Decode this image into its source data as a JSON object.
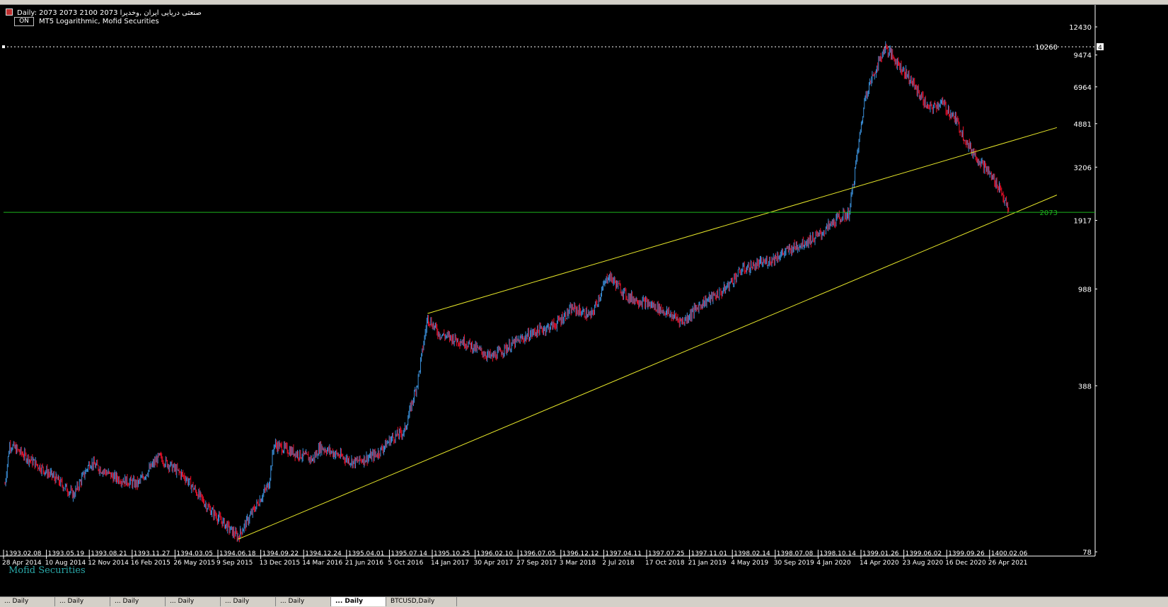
{
  "header": {
    "info_line": "Daily:  2073 2073 2100 2073  صنعتی دریایی ایران ,وخدیرا",
    "info_line2": "MT5 Logarithmic, Mofid Securities",
    "on_label": "ON"
  },
  "watermark": "Mofid Securities",
  "price_axis": {
    "labels": [
      "12430",
      "10260",
      "9474",
      "6964",
      "4881",
      "3206",
      "2073",
      "1917",
      "988",
      "388",
      "78"
    ],
    "marker": "4"
  },
  "time_axis": {
    "top_labels": [
      "1393.02.08",
      "1393.05.19",
      "1393.08.21",
      "1393.11.27",
      "1394.03.05",
      "1394.06.18",
      "1394.09.22",
      "1394.12.24",
      "1395.04.01",
      "1395.07.14",
      "1395.10.25",
      "1396.02.10",
      "1396.07.05",
      "1396.12.12",
      "1397.04.11",
      "1397.07.25",
      "1397.11.01",
      "1398.02.14",
      "1398.07.08",
      "1398.10.14",
      "1399.01.26",
      "1399.06.02",
      "1399.09.26",
      "1400.02.06"
    ],
    "bottom_labels": [
      "28 Apr 2014",
      "10 Aug 2014",
      "12 Nov 2014",
      "16 Feb 2015",
      "26 May 2015",
      "9 Sep 2015",
      "13 Dec 2015",
      "14 Mar 2016",
      "21 Jun 2016",
      "5 Oct 2016",
      "14 Jan 2017",
      "30 Apr 2017",
      "27 Sep 2017",
      "3 Mar 2018",
      "2 Jul 2018",
      "17 Oct 2018",
      "21 Jan 2019",
      "4 May 2019",
      "30 Sep 2019",
      "4 Jan 2020",
      "14 Apr 2020",
      "23 Aug 2020",
      "16 Dec 2020",
      "26 Apr 2021"
    ]
  },
  "tabs": [
    "... Daily",
    "... Daily",
    "... Daily",
    "... Daily",
    "... Daily",
    "... Daily",
    "... Daily",
    "BTCUSD,Daily"
  ],
  "colors": {
    "up_candle": "#3a8fd8",
    "down_candle": "#e8102a",
    "trendline": "#e8e82a",
    "price_line": "#1cb31c",
    "high_line": "#ffffff",
    "background": "#000000",
    "axis_text": "#ffffff"
  },
  "chart_data": {
    "type": "candlestick",
    "scale": "log",
    "ylim": [
      78,
      12430
    ],
    "last_price": 2073,
    "max_price": 10260,
    "close_path": [
      [
        "2014-04-28",
        150
      ],
      [
        "2014-05-10",
        220
      ],
      [
        "2014-07-01",
        190
      ],
      [
        "2014-09-01",
        160
      ],
      [
        "2014-10-20",
        135
      ],
      [
        "2014-12-01",
        185
      ],
      [
        "2015-02-01",
        160
      ],
      [
        "2015-04-01",
        150
      ],
      [
        "2015-05-26",
        195
      ],
      [
        "2015-08-01",
        160
      ],
      [
        "2015-10-01",
        118
      ],
      [
        "2015-12-13",
        90
      ],
      [
        "2016-03-01",
        150
      ],
      [
        "2016-03-14",
        220
      ],
      [
        "2016-06-21",
        190
      ],
      [
        "2016-07-10",
        215
      ],
      [
        "2016-10-05",
        185
      ],
      [
        "2016-12-01",
        200
      ],
      [
        "2017-01-10",
        235
      ],
      [
        "2017-02-10",
        250
      ],
      [
        "2017-03-15",
        400
      ],
      [
        "2017-04-10",
        750
      ],
      [
        "2017-05-10",
        640
      ],
      [
        "2017-07-15",
        590
      ],
      [
        "2017-09-20",
        510
      ],
      [
        "2017-11-20",
        590
      ],
      [
        "2018-01-10",
        655
      ],
      [
        "2018-03-01",
        700
      ],
      [
        "2018-04-15",
        820
      ],
      [
        "2018-06-01",
        760
      ],
      [
        "2018-07-15",
        1130
      ],
      [
        "2018-09-01",
        920
      ],
      [
        "2018-11-15",
        830
      ],
      [
        "2019-01-21",
        720
      ],
      [
        "2019-03-10",
        860
      ],
      [
        "2019-05-04",
        970
      ],
      [
        "2019-06-20",
        1190
      ],
      [
        "2019-08-30",
        1300
      ],
      [
        "2019-11-01",
        1480
      ],
      [
        "2020-01-04",
        1660
      ],
      [
        "2020-02-20",
        1950
      ],
      [
        "2020-03-20",
        2050
      ],
      [
        "2020-05-01",
        6500
      ],
      [
        "2020-06-20",
        10260
      ],
      [
        "2020-08-23",
        7500
      ],
      [
        "2020-10-10",
        5600
      ],
      [
        "2020-11-10",
        6000
      ],
      [
        "2020-12-16",
        5100
      ],
      [
        "2021-01-20",
        3900
      ],
      [
        "2021-03-01",
        3200
      ],
      [
        "2021-04-10",
        2600
      ],
      [
        "2021-05-01",
        2073
      ]
    ],
    "trendlines": [
      {
        "from": [
          "2017-04-10",
          780
        ],
        "to": [
          "2021-09-01",
          4700
        ]
      },
      {
        "from": [
          "2015-12-13",
          88
        ],
        "to": [
          "2021-09-01",
          2450
        ]
      }
    ]
  }
}
